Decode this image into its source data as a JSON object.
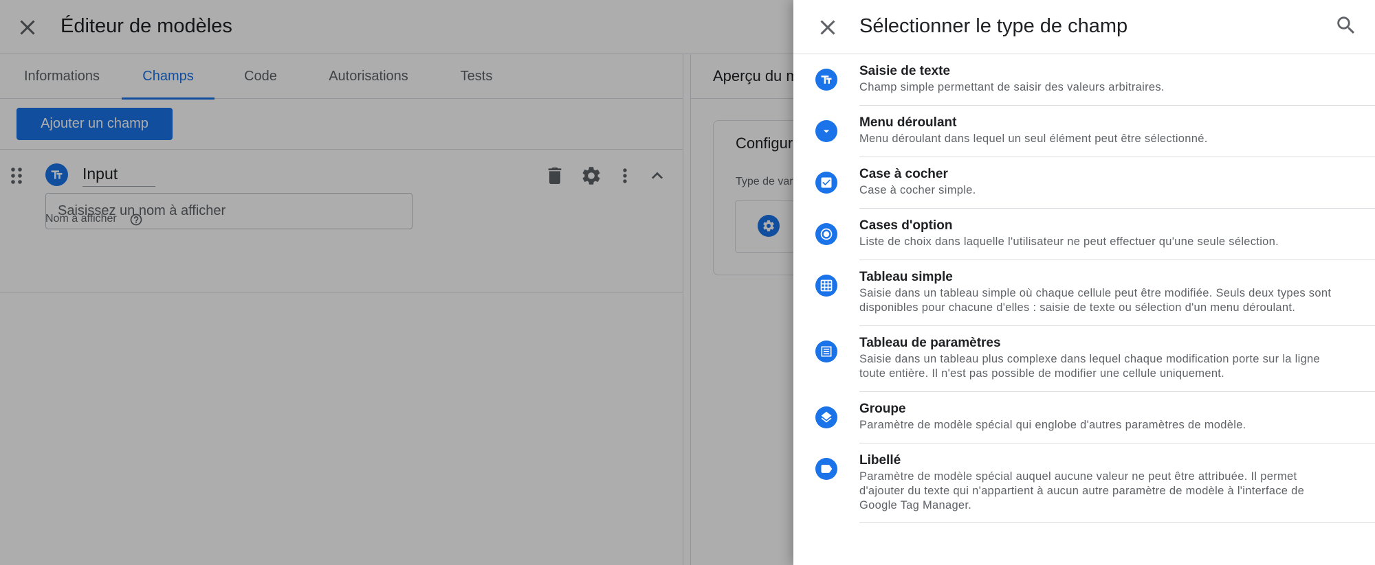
{
  "editor": {
    "title": "Éditeur de modèles",
    "tabs": [
      {
        "label": "Informations"
      },
      {
        "label": "Champs",
        "active": true
      },
      {
        "label": "Code"
      },
      {
        "label": "Autorisations"
      },
      {
        "label": "Tests"
      }
    ],
    "add_field_label": "Ajouter un champ",
    "field": {
      "name": "Input",
      "display_name_label": "Nom à afficher",
      "display_name_placeholder": "Saisissez un nom à afficher"
    },
    "preview": {
      "title_partial": "Aperçu du m",
      "config_partial": "Configur",
      "var_type_partial": "Type de var"
    }
  },
  "drawer": {
    "title": "Sélectionner le type de champ",
    "items": [
      {
        "title": "Saisie de texte",
        "description": "Champ simple permettant de saisir des valeurs arbitraires.",
        "icon": "text-input-icon"
      },
      {
        "title": "Menu déroulant",
        "description": "Menu déroulant dans lequel un seul élément peut être sélectionné.",
        "icon": "dropdown-icon"
      },
      {
        "title": "Case à cocher",
        "description": "Case à cocher simple.",
        "icon": "checkbox-icon"
      },
      {
        "title": "Cases d'option",
        "description": "Liste de choix dans laquelle l'utilisateur ne peut effectuer qu'une seule sélection.",
        "icon": "radio-icon"
      },
      {
        "title": "Tableau simple",
        "description": "Saisie dans un tableau simple où chaque cellule peut être modifiée. Seuls deux types sont disponibles pour chacune d'elles : saisie de texte ou sélection d'un menu déroulant.",
        "icon": "grid-table-icon"
      },
      {
        "title": "Tableau de paramètres",
        "description": "Saisie dans un tableau plus complexe dans lequel chaque modification porte sur la ligne toute entière. Il n'est pas possible de modifier une cellule uniquement.",
        "icon": "param-table-icon"
      },
      {
        "title": "Groupe",
        "description": "Paramètre de modèle spécial qui englobe d'autres paramètres de modèle.",
        "icon": "layers-icon"
      },
      {
        "title": "Libellé",
        "description": "Paramètre de modèle spécial auquel aucune valeur ne peut être attribuée. Il permet d'ajouter du texte qui n'appartient à aucun autre paramètre de modèle à l'interface de Google Tag Manager.",
        "icon": "label-icon"
      }
    ]
  },
  "colors": {
    "accent": "#1a73e8",
    "scrim": "rgba(0,0,0,0.32)"
  }
}
